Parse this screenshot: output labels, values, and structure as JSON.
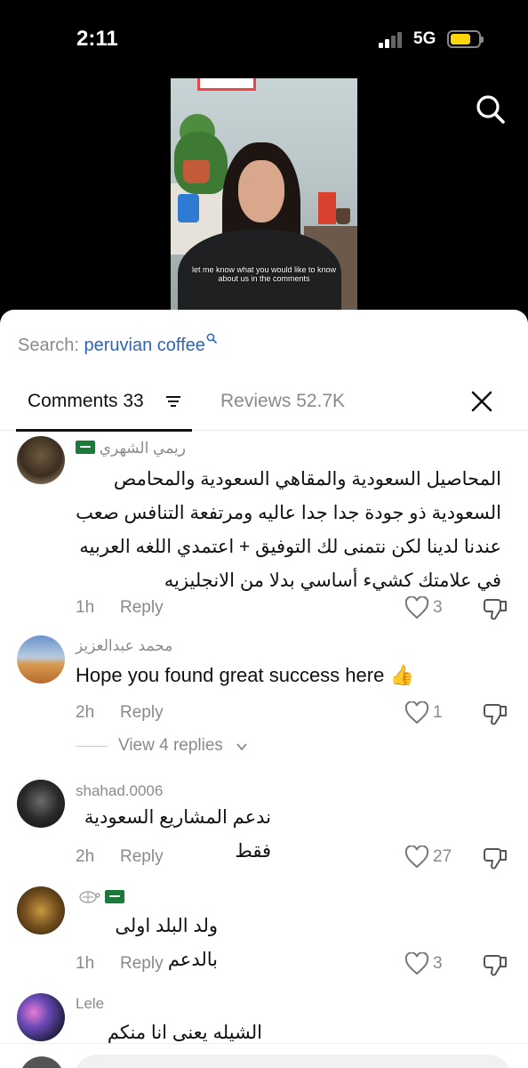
{
  "status_bar": {
    "time": "2:11",
    "network": "5G"
  },
  "video": {
    "caption": "let me know what you would like to know about us in the comments"
  },
  "search": {
    "prefix": "Search:",
    "query": "peruvian coffee"
  },
  "tabs": {
    "comments_label": "Comments 33",
    "reviews_label": "Reviews 52.7K"
  },
  "comments": [
    {
      "username": "ريمي الشهري",
      "text": "المحاصيل السعودية والمقاهي السعودية والمحامص السعودية ذو جودة جدا جدا عاليه ومرتفعة التنافس صعب عندنا لدينا لكن نتمنى لك التوفيق + اعتمدي اللغه العربيه في علامتك كشيء أساسي بدلا من الانجليزيه",
      "age": "1h",
      "reply": "Reply",
      "likes": "3"
    },
    {
      "username": "محمد عبدالعزيز",
      "text": "Hope you found great success here 👍",
      "age": "2h",
      "reply": "Reply",
      "likes": "1",
      "view_replies": "View 4 replies"
    },
    {
      "username": "shahad.0006",
      "text": "ندعم المشاريع السعودية فقط",
      "age": "2h",
      "reply": "Reply",
      "likes": "27"
    },
    {
      "username": "",
      "text": "ولد البلد اولى بالدعم",
      "age": "1h",
      "reply": "Reply",
      "likes": "3"
    },
    {
      "username": "Lele",
      "text": "الشيله يعنى انا منكم وفيكم"
    }
  ],
  "colors": {
    "accent_query": "#2e63b5",
    "muted": "#8a8a8a",
    "flag_green": "#1b7a3b",
    "battery": "#ffd60a"
  }
}
